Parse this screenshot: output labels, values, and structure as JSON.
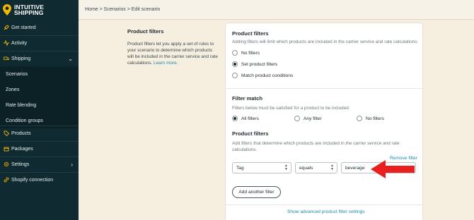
{
  "brand": {
    "line1": "INTUITIVE",
    "line2": "SHIPPING",
    "accent": "#f2b705"
  },
  "sidebar": {
    "items": [
      {
        "label": "Get started",
        "icon": "rocket-icon"
      },
      {
        "label": "Activity",
        "icon": "activity-icon"
      },
      {
        "label": "Shipping",
        "icon": "truck-icon"
      },
      {
        "label": "Scenarios"
      },
      {
        "label": "Zones"
      },
      {
        "label": "Rate blending"
      },
      {
        "label": "Condition groups"
      },
      {
        "label": "Products",
        "icon": "tag-icon"
      },
      {
        "label": "Packages",
        "icon": "box-icon"
      },
      {
        "label": "Settings",
        "icon": "gear-icon"
      },
      {
        "label": "Shopify connection",
        "icon": "link-icon"
      }
    ]
  },
  "breadcrumb": "Home > Scenarios > Edit scenario",
  "description": {
    "title": "Product filters",
    "text": "Product filters let you apply a set of rules to your scenario to determine which products will be included in the carrier service and rate calculations.",
    "link": "Learn more."
  },
  "card": {
    "product_filters": {
      "title": "Product filters",
      "help": "Adding filters will limit which products are included in the carrier service and rate calculations.",
      "options": [
        "No filters",
        "Set product filters",
        "Match product conditions"
      ],
      "selected": "Set product filters"
    },
    "filter_match": {
      "title": "Filter match",
      "help": "Filters below must be satisfied for a product to be included.",
      "options": [
        "All filters",
        "Any filter",
        "No filters"
      ],
      "selected": "All filters"
    },
    "filters": {
      "title": "Product filters",
      "help": "Add filters that determine which products are included in the carrier service and rate calculations.",
      "remove_label": "Remove filter",
      "field": "Tag",
      "operator": "equals",
      "value": "beverage",
      "add_label": "Add another filter",
      "advanced_label": "Show advanced product filter settings"
    }
  }
}
